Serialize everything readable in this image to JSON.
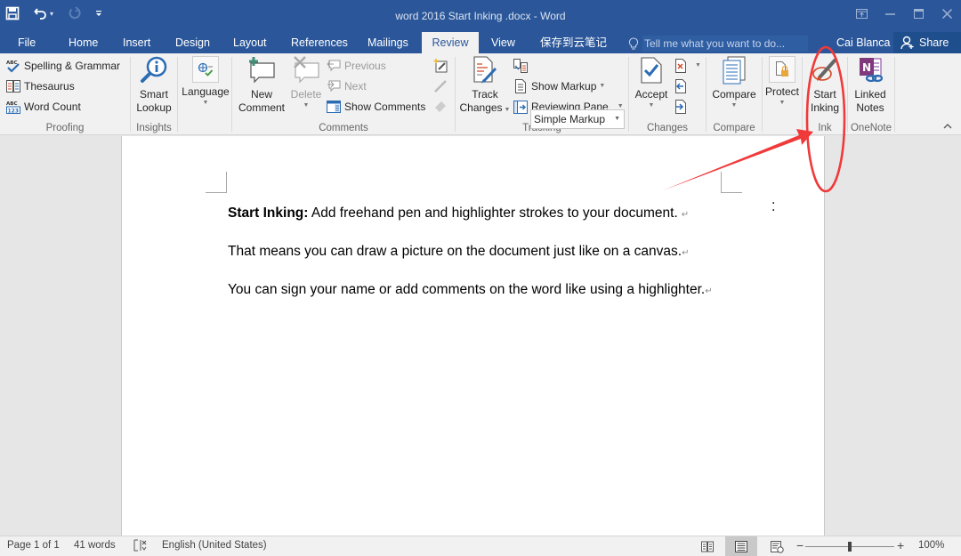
{
  "titlebar": {
    "title": "word 2016 Start Inking .docx - Word",
    "qat": {
      "save_icon": "save-icon",
      "undo_icon": "undo-icon",
      "redo_icon": "redo-icon",
      "customize_icon": "customize-qat-icon"
    },
    "window_controls": [
      "ribbon-display-options",
      "minimize",
      "maximize",
      "close"
    ]
  },
  "tabs": [
    {
      "label": "File",
      "active": false
    },
    {
      "label": "Home",
      "active": false
    },
    {
      "label": "Insert",
      "active": false
    },
    {
      "label": "Design",
      "active": false
    },
    {
      "label": "Layout",
      "active": false
    },
    {
      "label": "References",
      "active": false
    },
    {
      "label": "Mailings",
      "active": false
    },
    {
      "label": "Review",
      "active": true
    },
    {
      "label": "View",
      "active": false
    },
    {
      "label": "保存到云笔记",
      "active": false
    }
  ],
  "tell_me": {
    "placeholder": "Tell me what you want to do..."
  },
  "user": {
    "name": "Cai Blanca"
  },
  "share": {
    "label": "Share"
  },
  "ribbon": {
    "proofing": {
      "label": "Proofing",
      "spelling": "Spelling & Grammar",
      "thesaurus": "Thesaurus",
      "word_count": "Word Count"
    },
    "insights": {
      "label": "Insights",
      "smart_lookup_1": "Smart",
      "smart_lookup_2": "Lookup"
    },
    "language": {
      "label": "Language"
    },
    "comments": {
      "label": "Comments",
      "new_1": "New",
      "new_2": "Comment",
      "delete": "Delete",
      "previous": "Previous",
      "next": "Next",
      "show_comments": "Show Comments"
    },
    "tracking": {
      "label": "Tracking",
      "track_1": "Track",
      "track_2": "Changes",
      "markup_select": "Simple Markup",
      "show_markup": "Show Markup",
      "reviewing_pane": "Reviewing Pane"
    },
    "changes": {
      "label": "Changes",
      "accept": "Accept"
    },
    "compare": {
      "label": "Compare",
      "compare": "Compare"
    },
    "protect": {
      "protect": "Protect"
    },
    "ink": {
      "label": "Ink",
      "start_1": "Start",
      "start_2": "Inking"
    },
    "onenote": {
      "label": "OneNote",
      "linked_1": "Linked",
      "linked_2": "Notes"
    }
  },
  "document": {
    "p1_bold": "Start Inking:",
    "p1_rest": " Add freehand pen and highlighter strokes to your document.",
    "p2": "That means you can draw a picture on the document just like on a canvas.",
    "p3": "You can sign your name or add comments on the word like using a highlighter.",
    "para_mark": "↵"
  },
  "statusbar": {
    "page": "Page 1 of 1",
    "words": "41 words",
    "language": "English (United States)",
    "zoom": "100%",
    "zoom_percent": 100
  },
  "annotation": {
    "color": "#f03a3a",
    "target": "Start Inking"
  },
  "colors": {
    "brand": "#2b579a",
    "ribbon_bg": "#f1f1f1",
    "doc_bg": "#e6e6e6"
  }
}
